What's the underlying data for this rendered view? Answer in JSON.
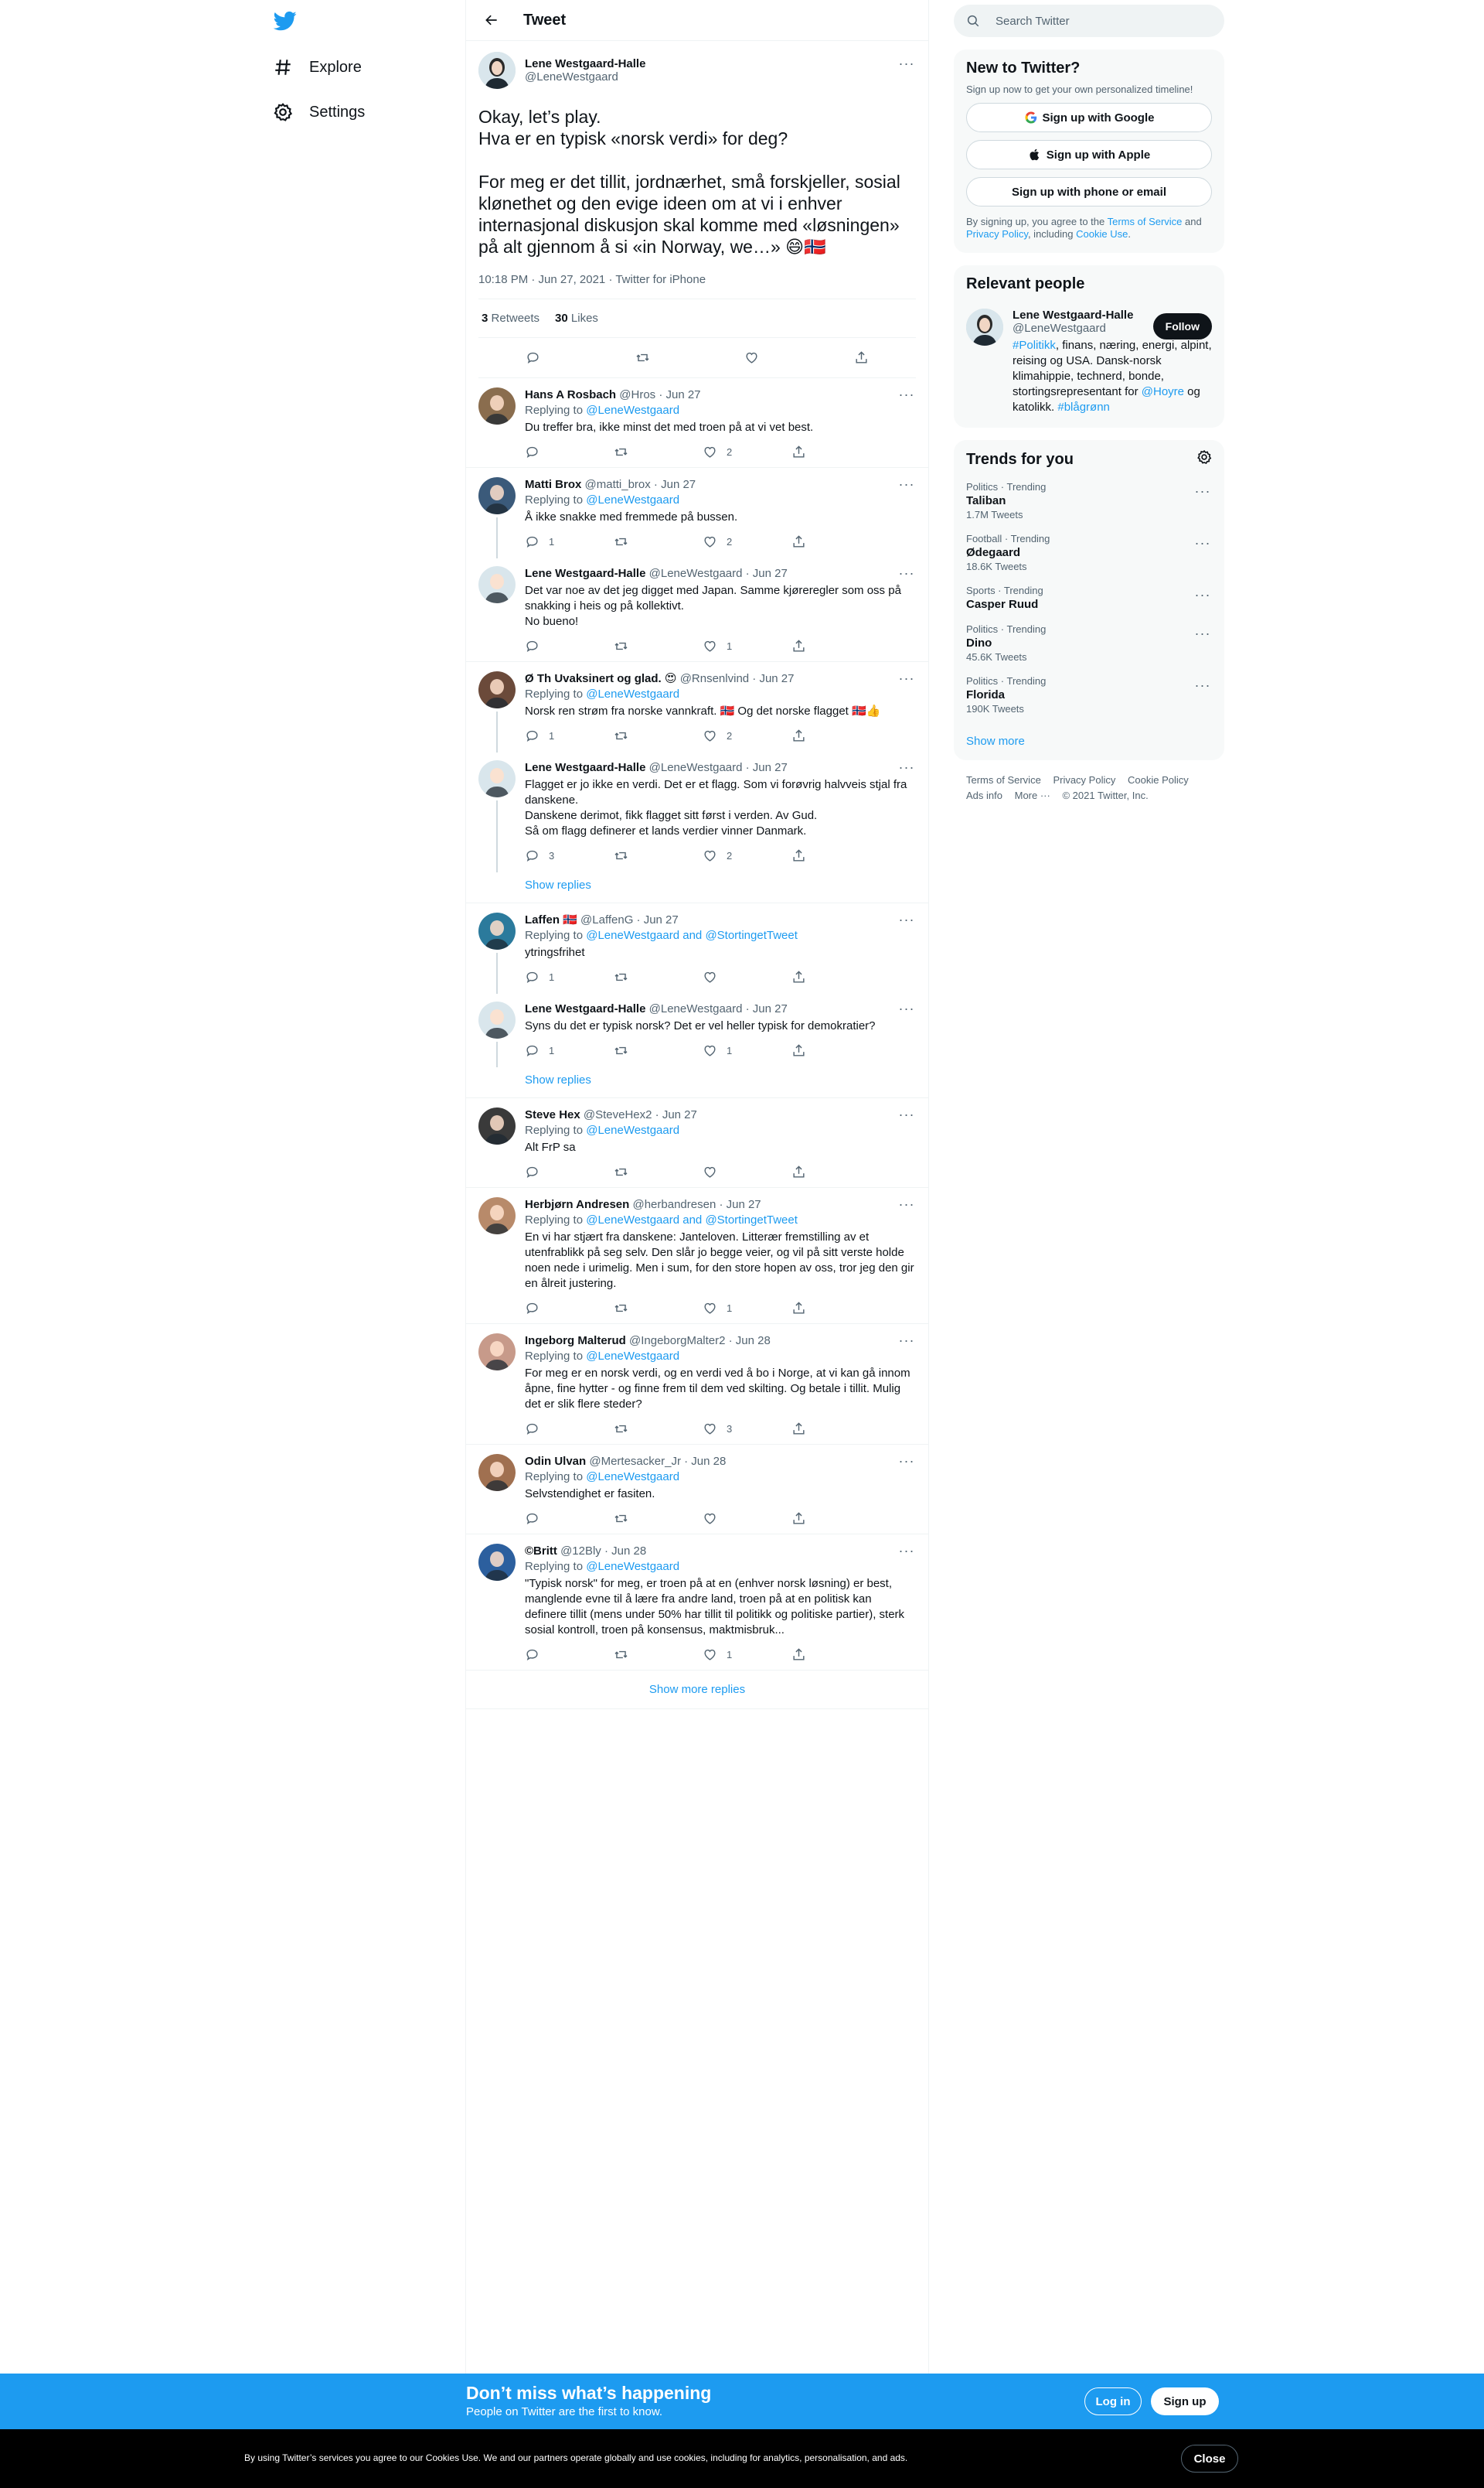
{
  "colors": {
    "accent": "#1d9bf0",
    "text": "#0f1419",
    "muted": "#536471",
    "border": "#eff3f4",
    "like_red": "#f91880"
  },
  "nav": {
    "logo_icon": "twitter-bird-icon",
    "items": [
      {
        "label": "Explore",
        "icon": "hashtag-icon"
      },
      {
        "label": "Settings",
        "icon": "gear-icon"
      }
    ]
  },
  "header": {
    "title": "Tweet"
  },
  "main_tweet": {
    "name": "Lene Westgaard-Halle",
    "handle": "@LeneWestgaard",
    "text": "Okay, let’s play.\nHva er en typisk «norsk verdi» for deg?\n\nFor meg er det tillit, jordnærhet, små forskjeller, sosial klønethet og den evige ideen om at vi i enhver internasjonal diskusjon skal komme med «løsningen» på alt gjennom å si «in Norway, we…» 😄🇳🇴",
    "meta": "10:18 PM · Jun 27, 2021 · Twitter for iPhone",
    "retweets_count": "3",
    "retweets_label": "Retweets",
    "likes_count": "30",
    "likes_label": "Likes"
  },
  "replies": [
    {
      "name": "Hans A Rosbach",
      "handle": "@Hros · Jun 27",
      "replying_prefix": "Replying to ",
      "replying_to": "@LeneWestgaard",
      "text": "Du treffer bra, ikke minst det med troen på at vi vet best.",
      "replies": "",
      "retweets": "",
      "likes": "2"
    },
    {
      "name": "Matti Brox",
      "handle": "@matti_brox · Jun 27",
      "replying_prefix": "Replying to ",
      "replying_to": "@LeneWestgaard",
      "text": "Å ikke snakke med fremmede på bussen.",
      "replies": "1",
      "retweets": "",
      "likes": "2"
    },
    {
      "name": "Lene Westgaard-Halle",
      "handle": "@LeneWestgaard · Jun 27",
      "text": "Det var noe av det jeg digget med Japan. Samme kjøreregler som oss på snakking i heis og på kollektivt.\nNo bueno!",
      "replies": "",
      "retweets": "",
      "likes": "1"
    },
    {
      "name": "Ø Th Uvaksinert og glad. 😍",
      "handle": "@Rnsenlvind · Jun 27",
      "replying_prefix": "Replying to ",
      "replying_to": "@LeneWestgaard",
      "text": "Norsk ren strøm fra norske vannkraft. 🇳🇴 Og det norske flagget 🇳🇴👍",
      "replies": "1",
      "retweets": "",
      "likes": "2"
    },
    {
      "name": "Lene Westgaard-Halle",
      "handle": "@LeneWestgaard · Jun 27",
      "text": "Flagget er jo ikke en verdi. Det er et flagg. Som vi forøvrig halvveis stjal fra danskene.\nDanskene derimot, fikk flagget sitt først i verden. Av Gud.\nSå om flagg definerer et lands verdier vinner Danmark.",
      "replies": "3",
      "retweets": "",
      "likes": "2"
    },
    {
      "name": "Laffen 🇳🇴",
      "handle": "@LaffenG · Jun 27",
      "replying_prefix": "Replying to ",
      "replying_to": "@LeneWestgaard and @StortingetTweet",
      "text": "ytringsfrihet",
      "replies": "1",
      "retweets": "",
      "likes": ""
    },
    {
      "name": "Lene Westgaard-Halle",
      "handle": "@LeneWestgaard · Jun 27",
      "text": "Syns du det er typisk norsk? Det er vel heller typisk for demokratier?",
      "replies": "1",
      "retweets": "",
      "likes": "1"
    },
    {
      "name": "Steve Hex",
      "handle": "@SteveHex2 · Jun 27",
      "replying_prefix": "Replying to ",
      "replying_to": "@LeneWestgaard",
      "text": "Alt FrP sa",
      "replies": "",
      "retweets": "",
      "likes": ""
    },
    {
      "name": "Herbjørn Andresen",
      "handle": "@herbandresen · Jun 27",
      "replying_prefix": "Replying to ",
      "replying_to": "@LeneWestgaard and @StortingetTweet",
      "text": "En vi har stjært fra danskene: Janteloven. Litterær fremstilling av et utenfrablikk på seg selv. Den slår jo begge veier, og vil på sitt verste holde noen nede i urimelig. Men i sum, for den store hopen av oss, tror jeg den gir en ålreit justering.",
      "replies": "",
      "retweets": "",
      "likes": "1"
    },
    {
      "name": "Ingeborg Malterud",
      "handle": "@IngeborgMalter2 · Jun 28",
      "replying_prefix": "Replying to ",
      "replying_to": "@LeneWestgaard",
      "text": "For meg er en norsk verdi, og en verdi ved å bo i Norge, at vi kan gå innom åpne, fine hytter - og finne frem til dem ved skilting. Og betale i tillit. Mulig det er slik flere steder?",
      "replies": "",
      "retweets": "",
      "likes": "3"
    },
    {
      "name": "Odin Ulvan",
      "handle": "@Mertesacker_Jr · Jun 28",
      "replying_prefix": "Replying to ",
      "replying_to": "@LeneWestgaard",
      "text": "Selvstendighet er fasiten.",
      "replies": "",
      "retweets": "",
      "likes": ""
    },
    {
      "name": "©Britt",
      "handle": "@12Bly · Jun 28",
      "replying_prefix": "Replying to ",
      "replying_to": "@LeneWestgaard",
      "text": "\"Typisk norsk\" for meg, er troen på at en (enhver norsk løsning) er best, manglende evne til å lære fra andre land, troen på at en politisk kan definere tillit (mens under 50% har tillit til politikk og politiske partier), sterk sosial kontroll, troen på konsensus, maktmisbruk...",
      "replies": "",
      "retweets": "",
      "likes": "1"
    }
  ],
  "show_replies_label": "Show replies",
  "show_more_replies_label": "Show more replies",
  "search": {
    "placeholder": "Search Twitter"
  },
  "new_to_twitter": {
    "title": "New to Twitter?",
    "subtitle": "Sign up now to get your own personalized timeline!",
    "google": "Sign up with Google",
    "apple": "Sign up with Apple",
    "phone": "Sign up with phone or email",
    "terms_1": "By signing up, you agree to the ",
    "terms_link": "Terms of Service",
    "terms_2": " and ",
    "privacy_link": "Privacy Policy",
    "terms_3": ", including ",
    "cookie_link": "Cookie Use",
    "terms_4": "."
  },
  "relevant_people": {
    "title": "Relevant people",
    "name": "Lene Westgaard-Halle",
    "handle": "@LeneWestgaard",
    "follow": "Follow",
    "bio_hashtag": "#Politikk",
    "bio_1": ", finans, næring, energi, alpint, reising og USA. Dansk-norsk klimahippie, technerd, bonde, stortingsrepresentant for ",
    "bio_mention": "@Hoyre",
    "bio_2": " og katolikk. ",
    "bio_hashtag2": "#blågrønn"
  },
  "trends": {
    "title": "Trends for you",
    "items": [
      {
        "meta": "Politics · Trending",
        "name": "Taliban",
        "count": "1.7M Tweets"
      },
      {
        "meta": "Football · Trending",
        "name": "Ødegaard",
        "count": "18.6K Tweets"
      },
      {
        "meta": "Sports · Trending",
        "name": "Casper Ruud",
        "count": ""
      },
      {
        "meta": "Politics · Trending",
        "name": "Dino",
        "count": "45.6K Tweets"
      },
      {
        "meta": "Politics · Trending",
        "name": "Florida",
        "count": "190K Tweets"
      }
    ],
    "show_more": "Show more"
  },
  "footer": {
    "links": [
      "Terms of Service",
      "Privacy Policy",
      "Cookie Policy"
    ],
    "links2": [
      "Ads info",
      "More ···",
      "© 2021 Twitter, Inc."
    ]
  },
  "signup_bar": {
    "title": "Don’t miss what’s happening",
    "subtitle": "People on Twitter are the first to know.",
    "login": "Log in",
    "signup": "Sign up"
  },
  "cookie_bar": {
    "text": "By using Twitter’s services you agree to our Cookies Use. We and our partners operate globally and use cookies, including for analytics, personalisation, and ads.",
    "close": "Close"
  }
}
